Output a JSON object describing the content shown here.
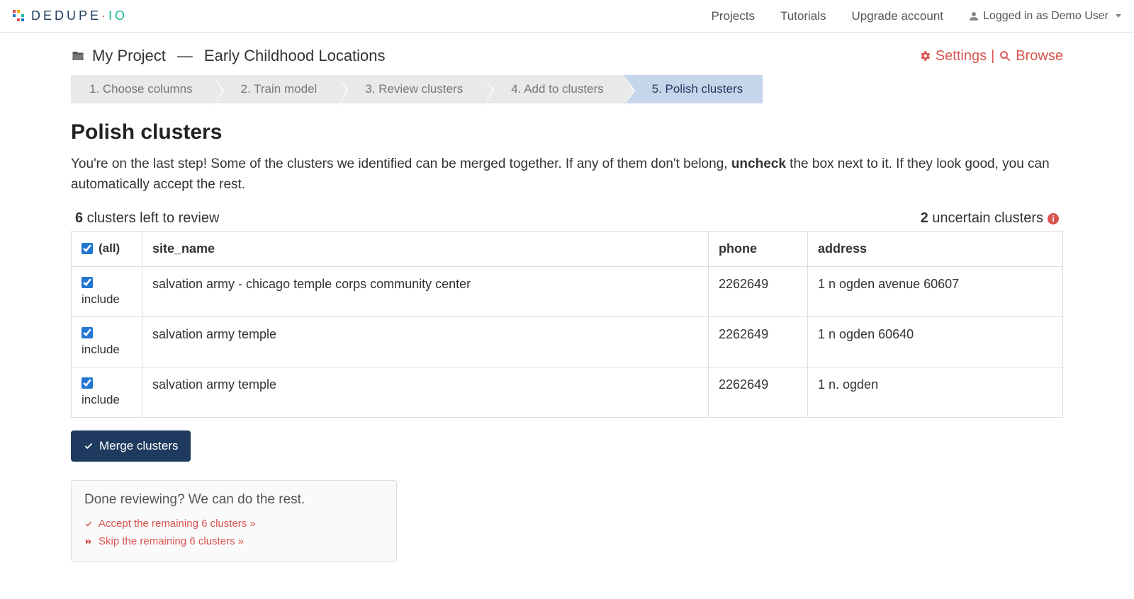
{
  "brand": {
    "text": "DEDUPE",
    "dot": "·",
    "suffix": "IO"
  },
  "nav": {
    "projects": "Projects",
    "tutorials": "Tutorials",
    "upgrade": "Upgrade account",
    "logged_in_prefix": "Logged in as ",
    "user": "Demo User"
  },
  "breadcrumb": {
    "project": "My Project",
    "separator": "—",
    "dataset": "Early Childhood Locations"
  },
  "right_links": {
    "settings": "Settings",
    "divider": "|",
    "browse": "Browse"
  },
  "steps": [
    {
      "label": "1. Choose columns",
      "active": false
    },
    {
      "label": "2. Train model",
      "active": false
    },
    {
      "label": "3. Review clusters",
      "active": false
    },
    {
      "label": "4. Add to clusters",
      "active": false
    },
    {
      "label": "5. Polish clusters",
      "active": true
    }
  ],
  "page": {
    "title": "Polish clusters",
    "intro_before": "You're on the last step! Some of the clusters we identified can be merged together. If any of them don't belong, ",
    "intro_bold": "uncheck",
    "intro_after": " the box next to it. If they look good, you can automatically accept the rest."
  },
  "counts": {
    "left_count": "6",
    "left_rest": " clusters left to review",
    "right_count": "2",
    "right_rest": " uncertain clusters"
  },
  "table": {
    "all_label": "(all)",
    "include_label": "include",
    "headers": {
      "site_name": "site_name",
      "phone": "phone",
      "address": "address"
    },
    "rows": [
      {
        "checked": true,
        "site_name": "salvation army - chicago temple corps community center",
        "phone": "2262649",
        "address": "1 n ogden avenue 60607"
      },
      {
        "checked": true,
        "site_name": "salvation army temple",
        "phone": "2262649",
        "address": "1 n ogden 60640"
      },
      {
        "checked": true,
        "site_name": "salvation army temple",
        "phone": "2262649",
        "address": "1 n. ogden"
      }
    ]
  },
  "buttons": {
    "merge": "Merge clusters"
  },
  "donebox": {
    "header": "Done reviewing? We can do the rest.",
    "accept": "Accept the remaining 6 clusters »",
    "skip": "Skip the remaining 6 clusters »"
  }
}
